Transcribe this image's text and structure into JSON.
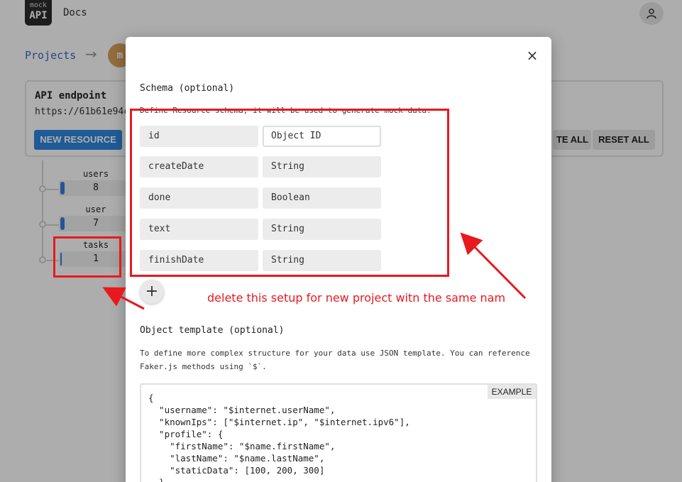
{
  "app": {
    "logo_top": "mock",
    "logo_bottom": "API",
    "docs_label": "Docs",
    "user_icon": "person-icon"
  },
  "breadcrumb": {
    "projects_label": "Projects",
    "arrow": "→",
    "avatar_letter": "m"
  },
  "endpoint": {
    "title": "API endpoint",
    "url": "https://61b61e94c",
    "new_resource_label": "NEW RESOURCE",
    "generate_all_label": "TE ALL",
    "reset_all_label": "RESET ALL"
  },
  "resources": [
    {
      "name": "users",
      "count": "8"
    },
    {
      "name": "user",
      "count": "7"
    },
    {
      "name": "tasks",
      "count": "1"
    }
  ],
  "modal": {
    "close_icon": "×",
    "schema_title": "Schema (optional)",
    "schema_description": "Define Resource schema, it will be used to generate mock data.",
    "schema_fields": [
      {
        "name": "id",
        "type": "Object ID"
      },
      {
        "name": "createDate",
        "type": "String"
      },
      {
        "name": "done",
        "type": "Boolean"
      },
      {
        "name": "text",
        "type": "String"
      },
      {
        "name": "finishDate",
        "type": "String"
      }
    ],
    "add_field_icon": "+",
    "template_title": "Object template (optional)",
    "template_description_1": "To define more complex structure for your data use JSON template. You can reference",
    "template_description_2": "Faker.js methods using `$`.",
    "example_label": "EXAMPLE",
    "template_code": [
      "{",
      "  \"username\": \"$internet.userName\",",
      "  \"knownIps\": [\"$internet.ip\", \"$internet.ipv6\"],",
      "  \"profile\": {",
      "    \"firstName\": \"$name.firstName\",",
      "    \"lastName\": \"$name.lastName\",",
      "    \"staticData\": [100, 200, 300]",
      "  }"
    ]
  },
  "annotation": {
    "text": "delete this setup for new project witn the same nam",
    "color": "#e8191f"
  }
}
